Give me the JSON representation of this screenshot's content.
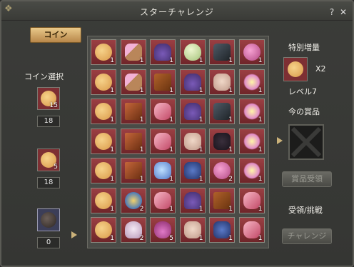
{
  "window": {
    "title": "スターチャレンジ",
    "help": "?",
    "close": "✕"
  },
  "left": {
    "tab_label": "コイン",
    "coin_select_label": "コイン選択",
    "coins": [
      {
        "name": "coin-1",
        "icon": "cookie-coin-icon",
        "badge": "15",
        "count": "18"
      },
      {
        "name": "coin-2",
        "icon": "cookie-coin-icon",
        "badge": "5",
        "count": "18"
      },
      {
        "name": "coin-3",
        "icon": "dark-coin-icon",
        "badge": "",
        "count": "0"
      }
    ]
  },
  "grid": {
    "rows": [
      [
        {
          "icon": "cookie",
          "n": "1"
        },
        {
          "icon": "wand",
          "n": "1"
        },
        {
          "icon": "hat",
          "n": "1"
        },
        {
          "icon": "egg",
          "n": "1"
        },
        {
          "icon": "fan",
          "n": "1"
        },
        {
          "icon": "orb",
          "n": "1"
        }
      ],
      [
        {
          "icon": "cookie",
          "n": "1"
        },
        {
          "icon": "wand",
          "n": "1"
        },
        {
          "icon": "scroll",
          "n": "1"
        },
        {
          "icon": "hat",
          "n": "1"
        },
        {
          "icon": "mask",
          "n": "1"
        },
        {
          "icon": "sparkle",
          "n": "1"
        }
      ],
      [
        {
          "icon": "cookie",
          "n": "1"
        },
        {
          "icon": "book",
          "n": "1"
        },
        {
          "icon": "tube",
          "n": "1"
        },
        {
          "icon": "hat",
          "n": "1"
        },
        {
          "icon": "fan",
          "n": "1"
        },
        {
          "icon": "sparkle",
          "n": "1"
        }
      ],
      [
        {
          "icon": "cookie",
          "n": "1"
        },
        {
          "icon": "book",
          "n": "1"
        },
        {
          "icon": "tube",
          "n": "1"
        },
        {
          "icon": "mask",
          "n": "1"
        },
        {
          "icon": "cat",
          "n": "1"
        },
        {
          "icon": "sparkle",
          "n": "1"
        }
      ],
      [
        {
          "icon": "cookie",
          "n": "1"
        },
        {
          "icon": "book",
          "n": "1"
        },
        {
          "icon": "blue",
          "n": "1"
        },
        {
          "icon": "bluecat",
          "n": "1"
        },
        {
          "icon": "orb",
          "n": "2"
        },
        {
          "icon": "sparkle",
          "n": "1"
        }
      ],
      [
        {
          "icon": "cookie",
          "n": "1"
        },
        {
          "icon": "star",
          "n": "2"
        },
        {
          "icon": "tube",
          "n": "1"
        },
        {
          "icon": "hat",
          "n": "1"
        },
        {
          "icon": "scroll",
          "n": "1"
        },
        {
          "icon": "tube",
          "n": "1"
        }
      ],
      [
        {
          "icon": "cookie",
          "n": "1"
        },
        {
          "icon": "ghost",
          "n": "2"
        },
        {
          "icon": "pot",
          "n": "5"
        },
        {
          "icon": "mask",
          "n": "1"
        },
        {
          "icon": "bluecat",
          "n": "1"
        },
        {
          "icon": "tube",
          "n": "1"
        }
      ]
    ]
  },
  "right": {
    "special_label": "特別増量",
    "multiplier": "X2",
    "level": "レベル7",
    "current_prize_label": "今の賞品",
    "claim_button": "賞品受領",
    "accept_label": "受領/挑戦",
    "challenge_button": "チャレンジ"
  }
}
